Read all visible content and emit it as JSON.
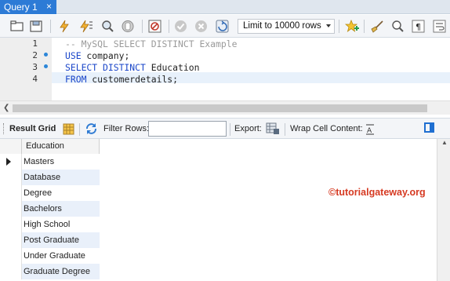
{
  "tab": {
    "title": "Query 1",
    "close": "×"
  },
  "toolbar": {
    "buttons": [
      {
        "name": "open-folder-icon",
        "glyph": "▭"
      },
      {
        "name": "save-icon",
        "glyph": "▤"
      },
      {
        "name": "execute-icon",
        "glyph": "⚡"
      },
      {
        "name": "execute-current-icon",
        "glyph": "⚡"
      },
      {
        "name": "explain-icon",
        "glyph": "🔍"
      },
      {
        "name": "stop-icon",
        "glyph": "✋"
      },
      {
        "name": "toggle-output-icon",
        "glyph": "⊘"
      },
      {
        "name": "commit-icon",
        "glyph": "✔"
      },
      {
        "name": "rollback-icon",
        "glyph": "✖"
      },
      {
        "name": "autocommit-icon",
        "glyph": "⟲"
      }
    ],
    "limit_value": "Limit to 10000 rows",
    "right_buttons": [
      {
        "name": "bookmark-star-icon",
        "glyph": "★"
      },
      {
        "name": "beautify-icon",
        "glyph": "✎"
      },
      {
        "name": "find-icon",
        "glyph": "⌕"
      },
      {
        "name": "invisible-chars-icon",
        "glyph": "¶"
      },
      {
        "name": "wrap-icon",
        "glyph": "↵"
      }
    ]
  },
  "editor": {
    "lines": [
      {
        "num": "1",
        "has_dot": false
      },
      {
        "num": "2",
        "has_dot": true
      },
      {
        "num": "3",
        "has_dot": true
      },
      {
        "num": "4",
        "has_dot": false
      }
    ],
    "line1": "-- MySQL SELECT DISTINCT Example",
    "line2_kw": "USE",
    "line2_rest": " company;",
    "line3_kw": "SELECT DISTINCT",
    "line3_rest": " Education",
    "line4_kw": "FROM",
    "line4_rest": " customerdetails;"
  },
  "result_toolbar": {
    "result_grid": "Result Grid",
    "filter_rows": "Filter Rows:",
    "filter_value": "",
    "export": "Export:",
    "wrap_content": "Wrap Cell Content:"
  },
  "grid": {
    "column": "Education",
    "rows": [
      "Masters",
      "Database",
      "Degree",
      "Bachelors",
      "High School",
      "Post Graduate",
      "Under Graduate",
      "Graduate Degree"
    ]
  },
  "watermark": "©tutorialgateway.org",
  "colors": {
    "tab_active": "#2d7bd6",
    "keyword": "#1a46c9",
    "comment": "#9a9a9a",
    "watermark": "#d63a22",
    "alt_row": "#e9f0fa"
  }
}
